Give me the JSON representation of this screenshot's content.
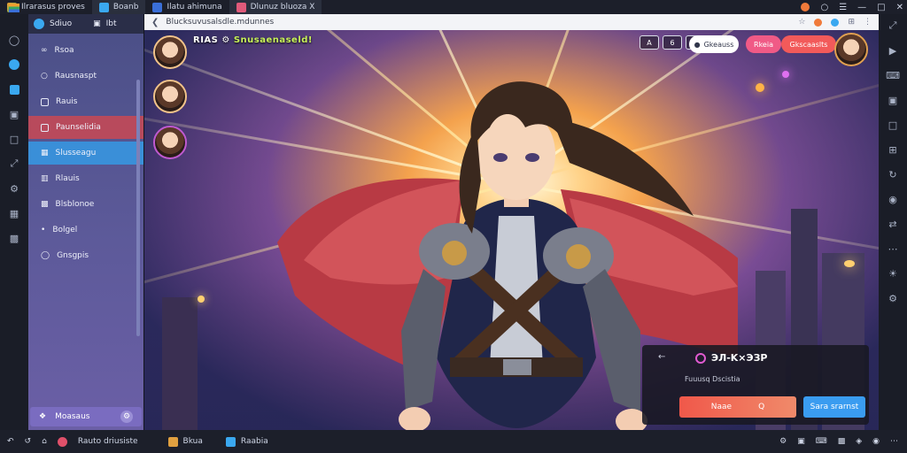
{
  "top_tabs": [
    {
      "label": "Ilrarasus proves",
      "color": "#f0a030"
    },
    {
      "label": "Boanb",
      "color": "#3aa8f0"
    },
    {
      "label": "Ilatu ahimuna",
      "color": "#3a6fd8"
    },
    {
      "label": "Dlunuz bluoza X",
      "color": "#e05a7a"
    }
  ],
  "url": "Blucksuvusalsdle.mdunnes",
  "sidebar": {
    "header_a": "Sdiuo",
    "header_b": "Ibt",
    "items": [
      {
        "label": "Rsoa"
      },
      {
        "label": "Rausnaspt"
      },
      {
        "label": "Rauis"
      },
      {
        "label": "Paunselidia"
      },
      {
        "label": "Slusseagu"
      },
      {
        "label": "Rlauis"
      },
      {
        "label": "Blsblonoe"
      },
      {
        "label": "Bolgel"
      },
      {
        "label": "Gnsgpis"
      }
    ],
    "footer_label": "Moasaus"
  },
  "game": {
    "hud_title": "RIAS",
    "hud_title_accent": "Snusaenaseld!",
    "hud_buttons": [
      "A",
      "6"
    ],
    "pill_white": "Gkeauss",
    "pill_pink": "Rkeia",
    "pill_coral": "Gkscaaslts",
    "dialog": {
      "title": "ЭЛ-Κ×ЭЗР",
      "subtitle": "Fuuusq Dscistia",
      "back": "←",
      "btn_a": "Naae",
      "btn_a_icon": "Q",
      "btn_b": "Sara srarnst"
    }
  },
  "bottom": {
    "items": [
      "Rauto driusiste",
      "Bkua",
      "Raabia"
    ],
    "item_colors": [
      "#e0506a",
      "#e0a040",
      "#3aa8f0"
    ]
  }
}
